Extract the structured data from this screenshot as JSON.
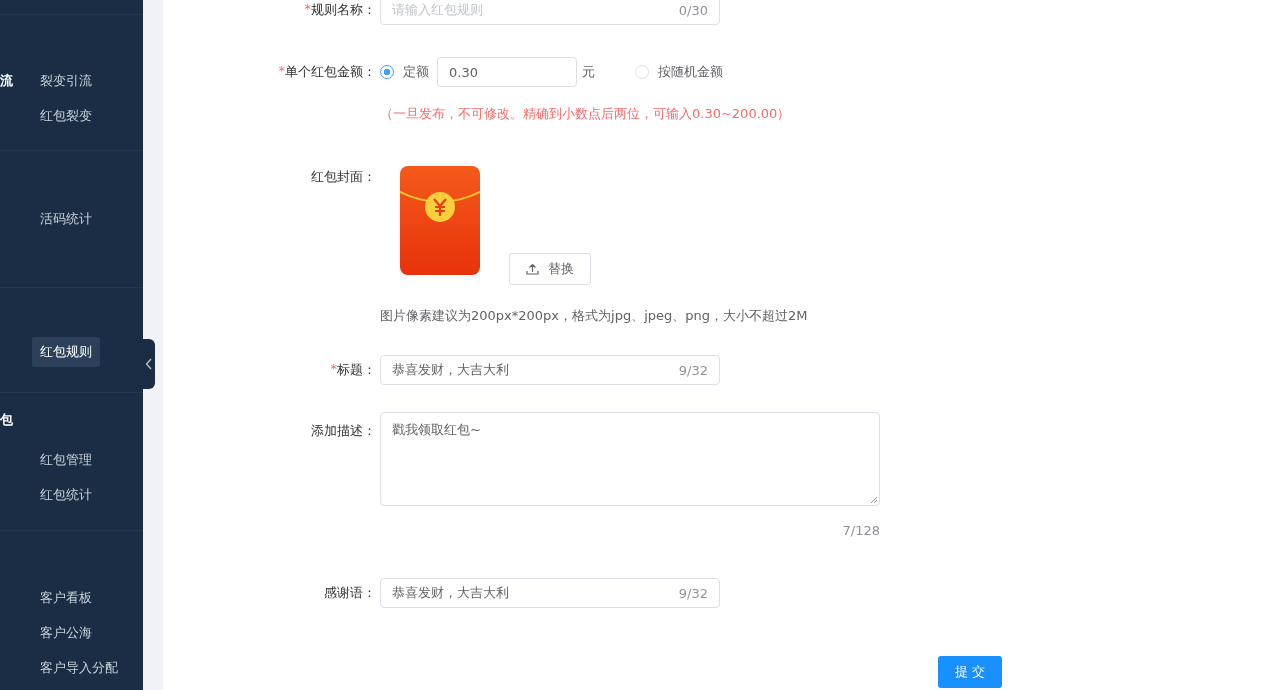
{
  "sidebar": {
    "groups": [
      {
        "header": "流",
        "items": [
          {
            "label": "裂变引流",
            "selected": false
          },
          {
            "label": "红包裂变",
            "selected": false
          }
        ]
      },
      {
        "items": [
          {
            "label": "活码统计",
            "selected": false
          }
        ]
      },
      {
        "items": [
          {
            "label": "红包规则",
            "selected": true
          }
        ]
      },
      {
        "header": "包",
        "items": [
          {
            "label": "红包管理",
            "selected": false
          },
          {
            "label": "红包统计",
            "selected": false
          }
        ]
      },
      {
        "items": [
          {
            "label": "客户看板",
            "selected": false
          },
          {
            "label": "客户公海",
            "selected": false
          },
          {
            "label": "客户导入分配",
            "selected": false
          }
        ]
      }
    ]
  },
  "form": {
    "required_mark": "*",
    "rule_name": {
      "label": "规则名称：",
      "required": true,
      "placeholder": "请输入红包规则",
      "counter": "0/30"
    },
    "amount": {
      "label": "单个红包金额：",
      "required": true,
      "options": [
        {
          "label": "定额",
          "selected": true,
          "value": "0.30",
          "unit": "元"
        },
        {
          "label": "按随机金额",
          "selected": false
        }
      ],
      "hint": "（一旦发布，不可修改。精确到小数点后两位，可输入0.30~200.00）"
    },
    "cover": {
      "label": "红包封面：",
      "button": "替换",
      "hint": "图片像素建议为200px*200px，格式为jpg、jpeg、png，大小不超过2M"
    },
    "title": {
      "label": "标题：",
      "required": true,
      "value": "恭喜发财，大吉大利",
      "counter": "9/32"
    },
    "description": {
      "label": "添加描述：",
      "required": false,
      "value": "戳我领取红包~",
      "counter": "7/128"
    },
    "thanks": {
      "label": "感谢语：",
      "required": false,
      "value": "恭喜发财，大吉大利",
      "counter": "9/32"
    },
    "submit": "提 交"
  }
}
